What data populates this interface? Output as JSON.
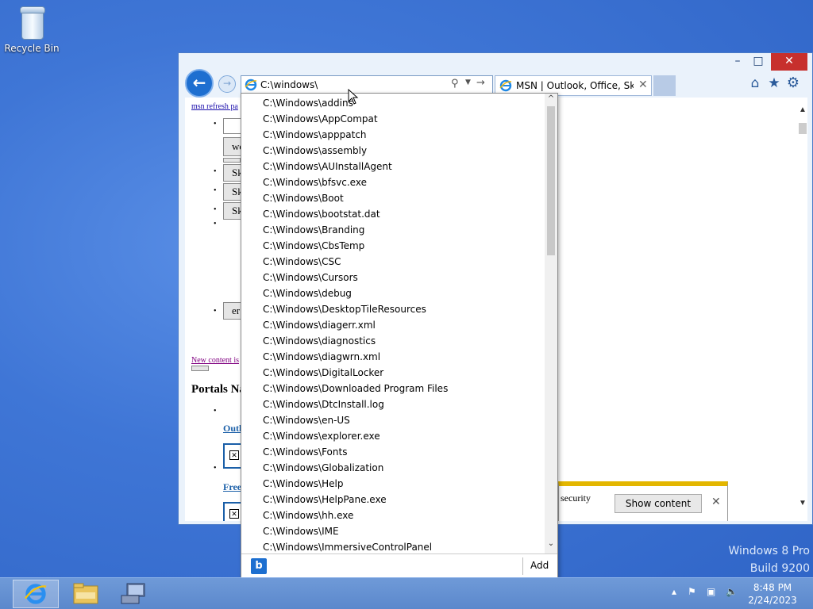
{
  "desktop": {
    "recycle_bin_label": "Recycle Bin"
  },
  "window": {
    "address": "C:\\windows\\",
    "tab_title": "MSN | Outlook, Office, Sky...",
    "minimize": "–",
    "maximize": "□",
    "close": "✕"
  },
  "page": {
    "refresh_link": "msn refresh pa",
    "buttons": [
      "we",
      "Sk",
      "Sk",
      "Sk",
      "er"
    ],
    "new_content_link": "New content is",
    "portals_heading": "Portals Na",
    "outlook_link": "Outl",
    "free_link": "Free"
  },
  "notification": {
    "text": "security",
    "show_content": "Show content"
  },
  "autocomplete": {
    "items": [
      "C:\\Windows\\addins",
      "C:\\Windows\\AppCompat",
      "C:\\Windows\\apppatch",
      "C:\\Windows\\assembly",
      "C:\\Windows\\AUInstallAgent",
      "C:\\Windows\\bfsvc.exe",
      "C:\\Windows\\Boot",
      "C:\\Windows\\bootstat.dat",
      "C:\\Windows\\Branding",
      "C:\\Windows\\CbsTemp",
      "C:\\Windows\\CSC",
      "C:\\Windows\\Cursors",
      "C:\\Windows\\debug",
      "C:\\Windows\\DesktopTileResources",
      "C:\\Windows\\diagerr.xml",
      "C:\\Windows\\diagnostics",
      "C:\\Windows\\diagwrn.xml",
      "C:\\Windows\\DigitalLocker",
      "C:\\Windows\\Downloaded Program Files",
      "C:\\Windows\\DtcInstall.log",
      "C:\\Windows\\en-US",
      "C:\\Windows\\explorer.exe",
      "C:\\Windows\\Fonts",
      "C:\\Windows\\Globalization",
      "C:\\Windows\\Help",
      "C:\\Windows\\HelpPane.exe",
      "C:\\Windows\\hh.exe",
      "C:\\Windows\\IME",
      "C:\\Windows\\ImmersiveControlPanel"
    ],
    "add_label": "Add",
    "bing_label": "b"
  },
  "watermark": {
    "line1": "Windows 8 Pro",
    "line2": "Build 9200"
  },
  "clock": {
    "time": "8:48 PM",
    "date": "2/24/2023"
  },
  "colors": {
    "accent": "#1e6fd0",
    "close": "#c7302d",
    "notif_bar": "#e3b600"
  }
}
